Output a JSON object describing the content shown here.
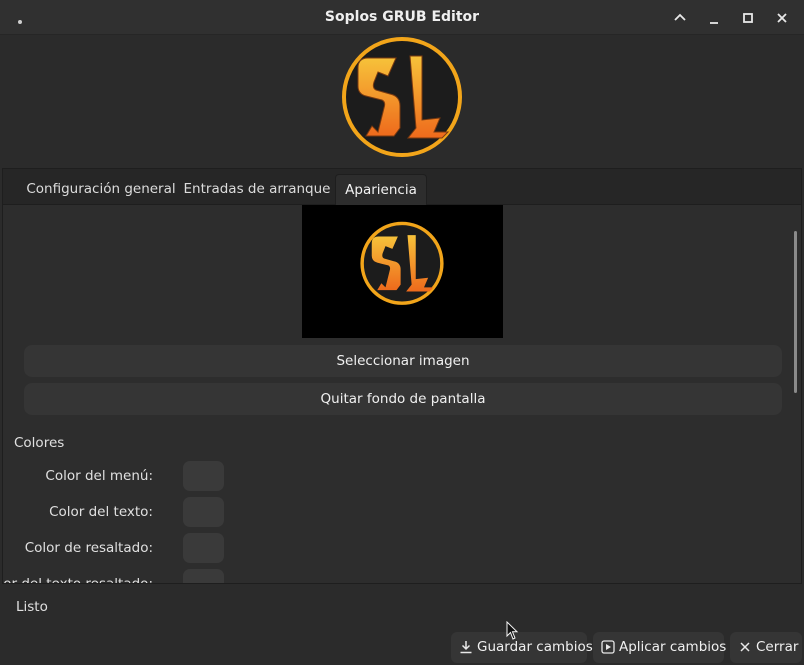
{
  "window": {
    "title": "Soplos GRUB Editor"
  },
  "tabs": [
    {
      "label": "Configuración general",
      "active": false
    },
    {
      "label": "Entradas de arranque",
      "active": false
    },
    {
      "label": "Apariencia",
      "active": true
    }
  ],
  "appearance": {
    "select_image_label": "Seleccionar imagen",
    "remove_wallpaper_label": "Quitar fondo de pantalla",
    "colors_section": "Colores",
    "colors": [
      {
        "label": "Color del menú:"
      },
      {
        "label": "Color del texto:"
      },
      {
        "label": "Color de resaltado:"
      },
      {
        "label": "Color del texto resaltado:"
      }
    ]
  },
  "status": {
    "text": "Listo"
  },
  "actions": {
    "save_label": "Guardar cambios",
    "apply_label": "Aplicar cambios",
    "close_label": "Cerrar"
  },
  "logo": {
    "letters": "SL",
    "ring_color": "#f2a51a",
    "fill_color": "#1c1c1c",
    "accent_color": "#f07d1e"
  }
}
